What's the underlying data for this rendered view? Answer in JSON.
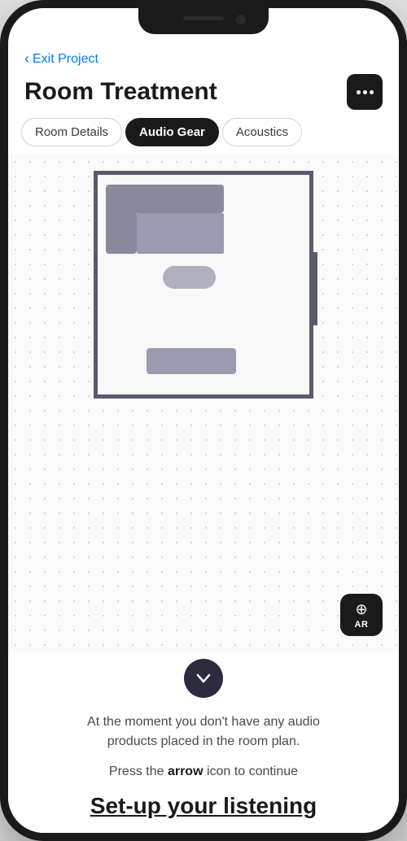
{
  "header": {
    "back_label": "Exit Project",
    "title": "Room Treatment",
    "more_button_label": "More options"
  },
  "tabs": {
    "items": [
      {
        "id": "room-details",
        "label": "Room Details",
        "active": false
      },
      {
        "id": "audio-gear",
        "label": "Audio Gear",
        "active": true
      },
      {
        "id": "acoustics",
        "label": "Acoustics",
        "active": false
      }
    ]
  },
  "ar_button": {
    "label": "AR"
  },
  "bottom": {
    "info_text": "At the moment you don't have any audio products placed in the room plan.",
    "hint_prefix": "Press the ",
    "hint_strong": "arrow",
    "hint_suffix": " icon to continue",
    "big_heading": "Set-up your listening"
  },
  "icons": {
    "back_chevron": "‹",
    "more_dots": "•••",
    "ar_symbol": "⊕",
    "chevron_down": "chevron-down"
  }
}
